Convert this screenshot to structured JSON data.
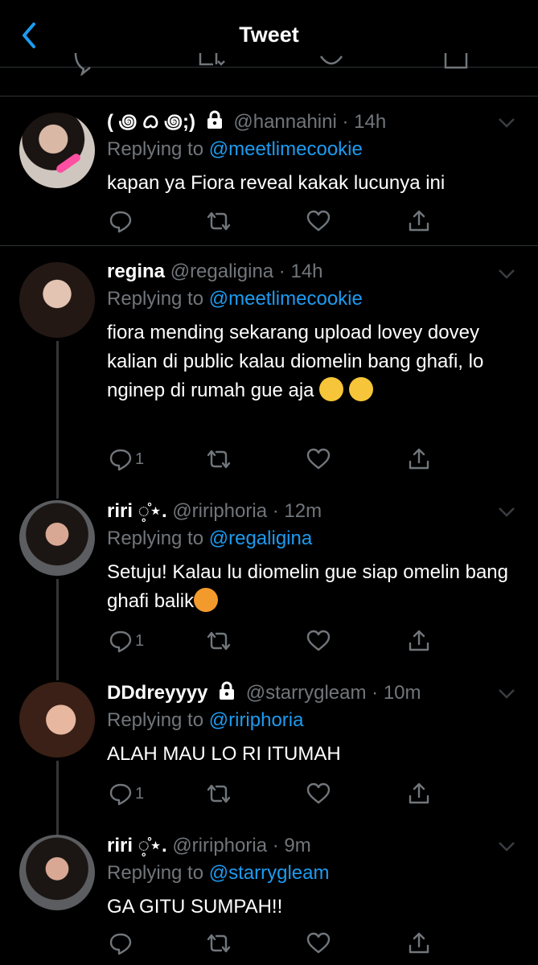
{
  "header": {
    "title": "Tweet"
  },
  "tweets": [
    {
      "name": "( ꩜ ᜊ ꩜;)",
      "handle": "@hannahini",
      "time": "14h",
      "locked": true,
      "replying_label": "Replying to",
      "replying_to": "@meetlimecookie",
      "text": "kapan ya Fiora reveal kakak lucunya ini",
      "reply_count": ""
    },
    {
      "name": "regina",
      "handle": "@regaligina",
      "time": "14h",
      "locked": false,
      "replying_label": "Replying to",
      "replying_to": "@meetlimecookie",
      "text": "fiora mending sekarang upload lovey dovey kalian di public kalau diomelin bang ghafi, lo nginep di rumah gue aja",
      "reply_count": "1"
    },
    {
      "name": "riri ◌̥̊⋆.",
      "handle": "@ririphoria",
      "time": "12m",
      "locked": false,
      "replying_label": "Replying to",
      "replying_to": "@regaligina",
      "text": "Setuju! Kalau lu diomelin gue siap omelin bang ghafi balik",
      "reply_count": "1"
    },
    {
      "name": "DDdreyyyy",
      "handle": "@starrygleam",
      "time": "10m",
      "locked": true,
      "replying_label": "Replying to",
      "replying_to": "@ririphoria",
      "text": "ALAH MAU LO RI ITUMAH",
      "reply_count": "1"
    },
    {
      "name": "riri ◌̥̊⋆.",
      "handle": "@ririphoria",
      "time": "9m",
      "locked": false,
      "replying_label": "Replying to",
      "replying_to": "@starrygleam",
      "text": "GA GITU SUMPAH!!",
      "reply_count": ""
    }
  ],
  "colors": {
    "background": "#000000",
    "accent": "#1d9bf0",
    "muted": "#71767b",
    "divider": "#2f3336"
  }
}
